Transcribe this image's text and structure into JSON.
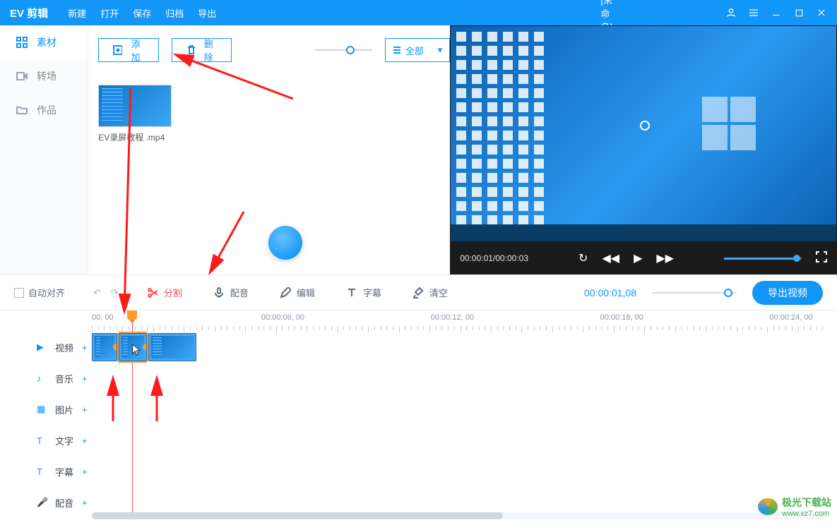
{
  "titlebar": {
    "logo": "EV 剪辑",
    "menu": [
      "新建",
      "打开",
      "保存",
      "归档",
      "导出"
    ],
    "docTitle": "[未命名]"
  },
  "sidebar": {
    "items": [
      {
        "label": "素材",
        "icon": "grid-icon"
      },
      {
        "label": "转场",
        "icon": "transition-icon"
      },
      {
        "label": "作品",
        "icon": "folder-icon"
      }
    ]
  },
  "contentToolbar": {
    "add": "添加",
    "delete": "删除",
    "filter": "全部"
  },
  "media": [
    {
      "name": "EV录屏教程 .mp4"
    }
  ],
  "preview": {
    "currentTime": "00:00:01",
    "duration": "00:00:03"
  },
  "toolrow": {
    "autoAlign": "自动对齐",
    "tools": {
      "split": "分割",
      "dub": "配音",
      "edit": "编辑",
      "subtitle": "字幕",
      "clear": "清空"
    },
    "time": "00:00:01,08",
    "export": "导出视频"
  },
  "ruler": {
    "marks": [
      "00, 00",
      "00:00:06, 00",
      "00:00:12, 00",
      "00:00:18, 00",
      "00:00:24, 00"
    ]
  },
  "tracks": [
    {
      "label": "视频",
      "icon": "play-square-icon"
    },
    {
      "label": "音乐",
      "icon": "music-icon"
    },
    {
      "label": "图片",
      "icon": "image-icon"
    },
    {
      "label": "文字",
      "icon": "text-icon"
    },
    {
      "label": "字幕",
      "icon": "caption-icon"
    },
    {
      "label": "配音",
      "icon": "mic-icon"
    }
  ],
  "watermark": {
    "name": "极光下载站",
    "url": "www.xz7.com"
  }
}
